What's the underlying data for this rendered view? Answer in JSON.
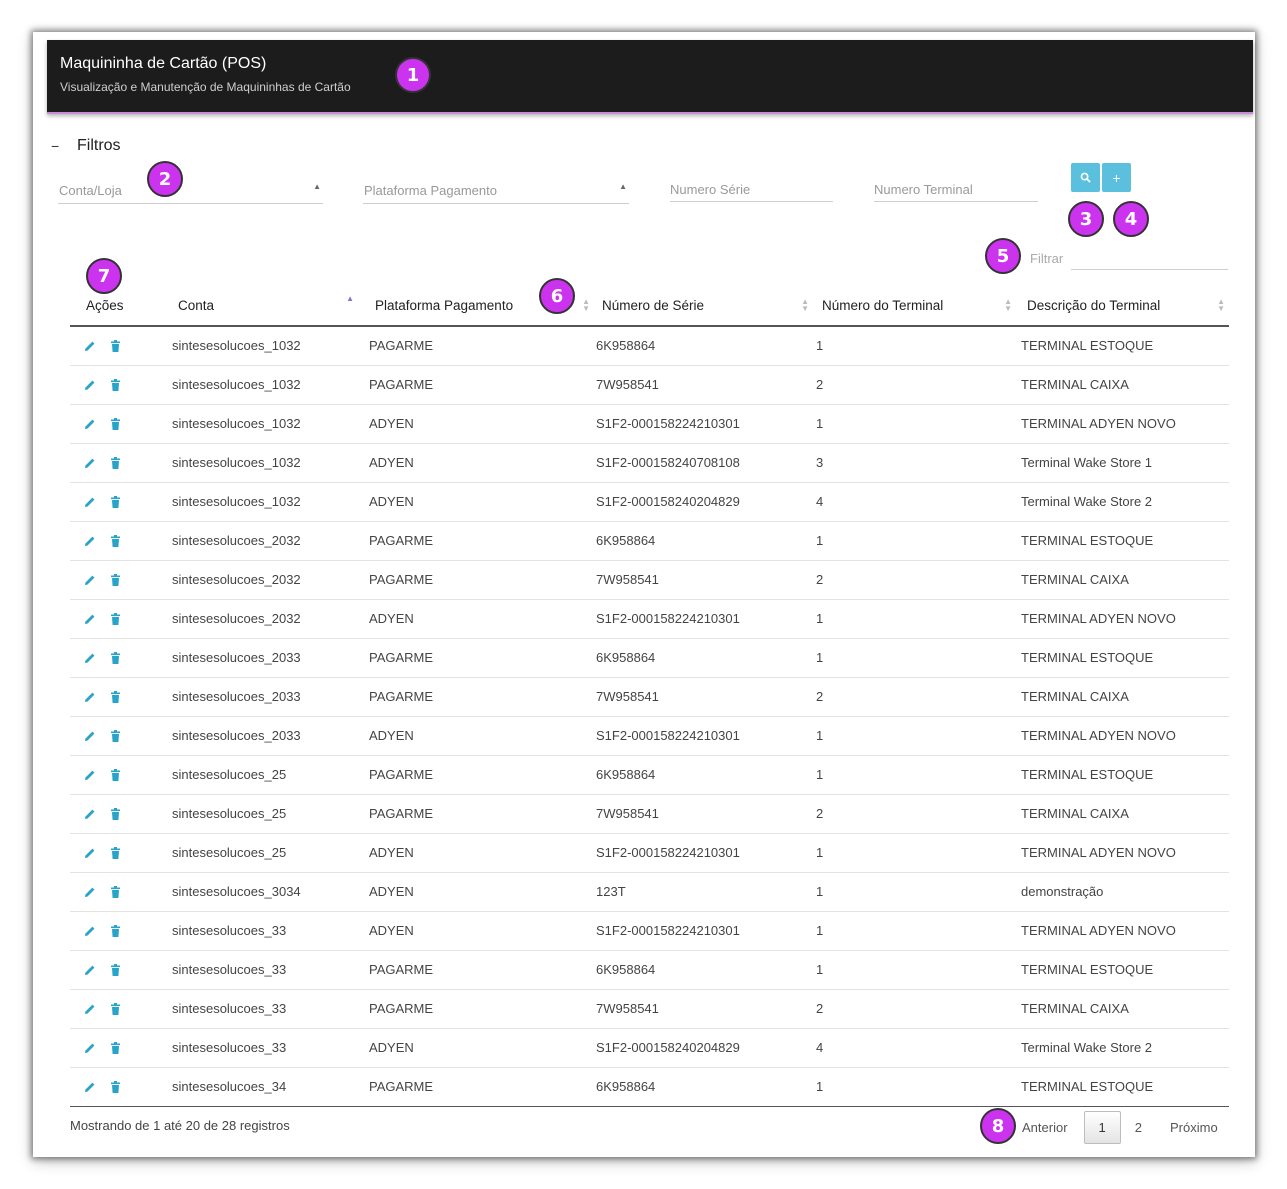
{
  "header": {
    "title": "Maquininha de Cartão (POS)",
    "subtitle": "Visualização e Manutenção de Maquininhas de Cartão"
  },
  "filters": {
    "toggle_symbol": "−",
    "label": "Filtros",
    "conta_loja_placeholder": "Conta/Loja",
    "plataforma_placeholder": "Plataforma Pagamento",
    "numero_serie_placeholder": "Numero Série",
    "numero_terminal_placeholder": "Numero Terminal",
    "search_button_icon": "search-icon",
    "add_button_label": "+"
  },
  "table_filter": {
    "label": "Filtrar",
    "value": ""
  },
  "table": {
    "columns": [
      "Ações",
      "Conta",
      "Plataforma Pagamento",
      "Número de Série",
      "Número do Terminal",
      "Descrição do Terminal"
    ],
    "sorted_column": "Conta",
    "rows": [
      [
        "sintesesolucoes_1032",
        "PAGARME",
        "6K958864",
        "1",
        "TERMINAL ESTOQUE"
      ],
      [
        "sintesesolucoes_1032",
        "PAGARME",
        "7W958541",
        "2",
        "TERMINAL CAIXA"
      ],
      [
        "sintesesolucoes_1032",
        "ADYEN",
        "S1F2-000158224210301",
        "1",
        "TERMINAL ADYEN NOVO"
      ],
      [
        "sintesesolucoes_1032",
        "ADYEN",
        "S1F2-000158240708108",
        "3",
        "Terminal Wake Store 1"
      ],
      [
        "sintesesolucoes_1032",
        "ADYEN",
        "S1F2-000158240204829",
        "4",
        "Terminal Wake Store 2"
      ],
      [
        "sintesesolucoes_2032",
        "PAGARME",
        "6K958864",
        "1",
        "TERMINAL ESTOQUE"
      ],
      [
        "sintesesolucoes_2032",
        "PAGARME",
        "7W958541",
        "2",
        "TERMINAL CAIXA"
      ],
      [
        "sintesesolucoes_2032",
        "ADYEN",
        "S1F2-000158224210301",
        "1",
        "TERMINAL ADYEN NOVO"
      ],
      [
        "sintesesolucoes_2033",
        "PAGARME",
        "6K958864",
        "1",
        "TERMINAL ESTOQUE"
      ],
      [
        "sintesesolucoes_2033",
        "PAGARME",
        "7W958541",
        "2",
        "TERMINAL CAIXA"
      ],
      [
        "sintesesolucoes_2033",
        "ADYEN",
        "S1F2-000158224210301",
        "1",
        "TERMINAL ADYEN NOVO"
      ],
      [
        "sintesesolucoes_25",
        "PAGARME",
        "6K958864",
        "1",
        "TERMINAL ESTOQUE"
      ],
      [
        "sintesesolucoes_25",
        "PAGARME",
        "7W958541",
        "2",
        "TERMINAL CAIXA"
      ],
      [
        "sintesesolucoes_25",
        "ADYEN",
        "S1F2-000158224210301",
        "1",
        "TERMINAL ADYEN NOVO"
      ],
      [
        "sintesesolucoes_3034",
        "ADYEN",
        "123T",
        "1",
        "demonstração"
      ],
      [
        "sintesesolucoes_33",
        "ADYEN",
        "S1F2-000158224210301",
        "1",
        "TERMINAL ADYEN NOVO"
      ],
      [
        "sintesesolucoes_33",
        "PAGARME",
        "6K958864",
        "1",
        "TERMINAL ESTOQUE"
      ],
      [
        "sintesesolucoes_33",
        "PAGARME",
        "7W958541",
        "2",
        "TERMINAL CAIXA"
      ],
      [
        "sintesesolucoes_33",
        "ADYEN",
        "S1F2-000158240204829",
        "4",
        "Terminal Wake Store 2"
      ],
      [
        "sintesesolucoes_34",
        "PAGARME",
        "6K958864",
        "1",
        "TERMINAL ESTOQUE"
      ]
    ]
  },
  "footer": {
    "info": "Mostrando de 1 até 20 de 28 registros",
    "prev_label": "Anterior",
    "pages": [
      "1",
      "2"
    ],
    "current_page": "1",
    "next_label": "Próximo"
  },
  "badges": [
    "1",
    "2",
    "3",
    "4",
    "5",
    "6",
    "7",
    "8"
  ],
  "colors": {
    "header_bg": "#1c1c1c",
    "accent_button": "#5bc0de",
    "action_icon": "#2aa3c8",
    "badge": "#cc33ee",
    "sort_active": "#8a6fd6"
  }
}
